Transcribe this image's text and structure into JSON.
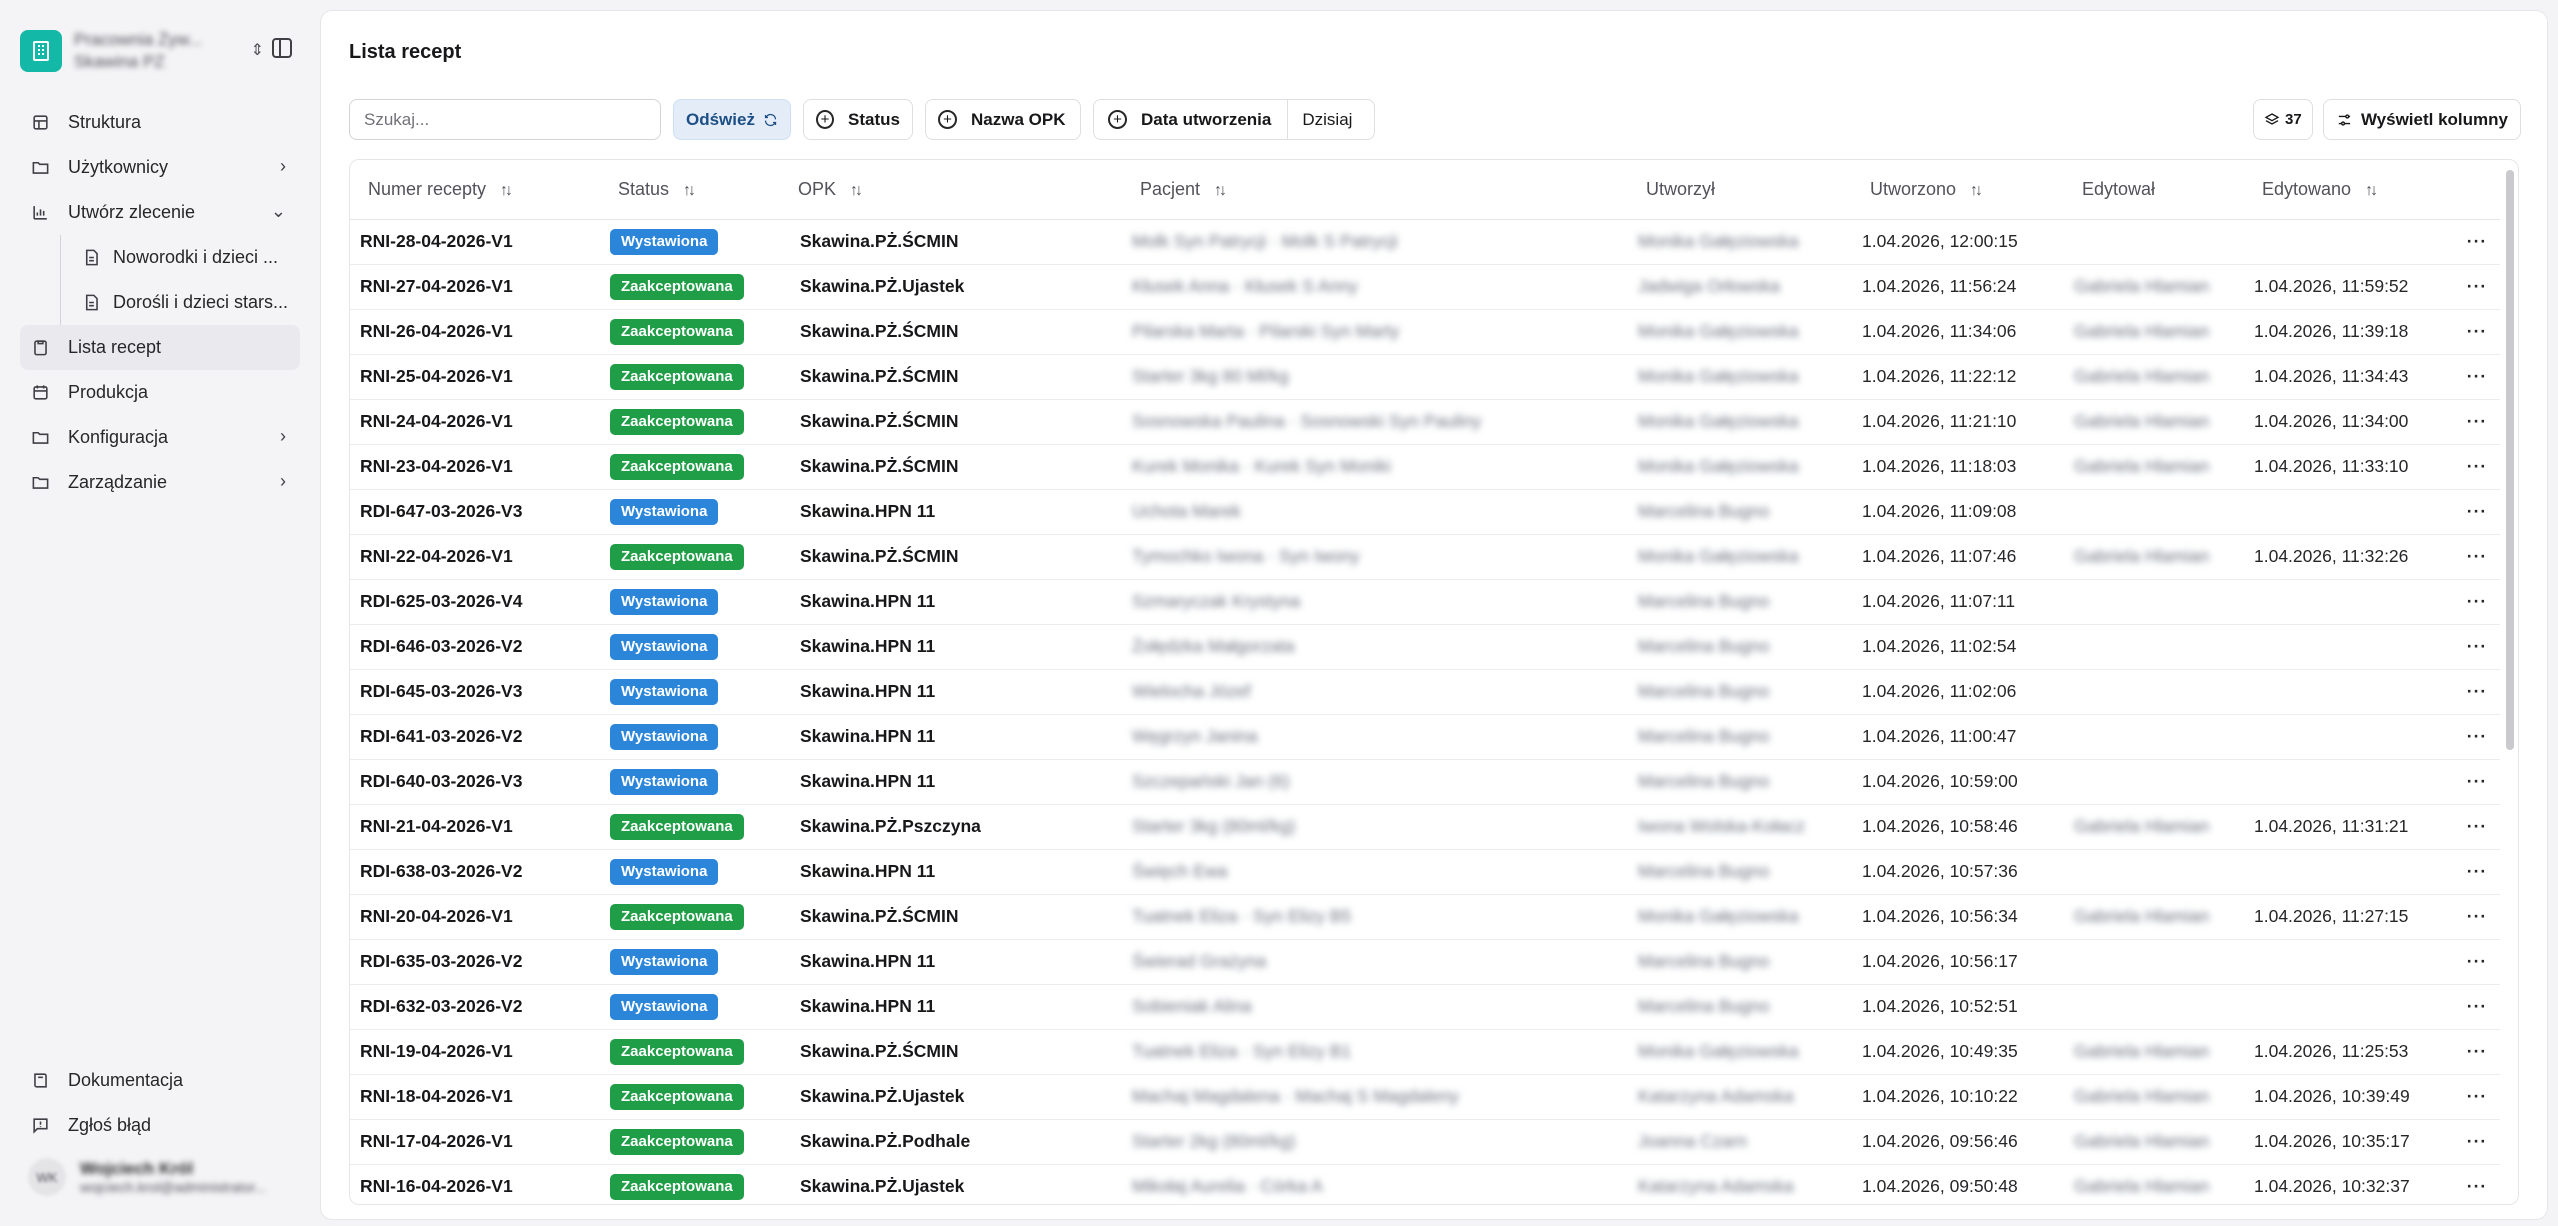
{
  "sidebar": {
    "org": {
      "name": "Pracownia Żyw...",
      "sub": "Skawina PZ"
    },
    "nav": [
      {
        "label": "Struktura",
        "icon": "building-icon"
      },
      {
        "label": "Użytkownicy",
        "icon": "folder-icon"
      },
      {
        "label": "Utwórz zlecenie",
        "icon": "chart-icon"
      },
      {
        "label": "Lista recept",
        "icon": "clipboard-icon"
      },
      {
        "label": "Produkcja",
        "icon": "calendar-icon"
      },
      {
        "label": "Konfiguracja",
        "icon": "folder-icon"
      },
      {
        "label": "Zarządzanie",
        "icon": "folder-icon"
      }
    ],
    "sub_items": [
      "Noworodki i dzieci ...",
      "Dorośli i dzieci stars..."
    ],
    "bottom": [
      "Dokumentacja",
      "Zgłoś błąd"
    ],
    "user": {
      "initials": "WK",
      "name": "Wojciech Król",
      "email": "wojciech.krol@administrator..."
    }
  },
  "main": {
    "title": "Lista recept",
    "toolbar": {
      "search_placeholder": "Szukaj...",
      "refresh": "Odśwież",
      "status": "Status",
      "opk": "Nazwa OPK",
      "date": "Data utworzenia",
      "date_value": "Dzisiaj",
      "count": "37",
      "columns": "Wyświetl kolumny"
    },
    "columns": [
      "Numer recepty",
      "Status",
      "OPK",
      "Pacjent",
      "Utworzył",
      "Utworzono",
      "Edytował",
      "Edytowano"
    ],
    "rows": [
      {
        "num": "RNI-28-04-2026-V1",
        "status": "Wystawiona",
        "opk": "Skawina.PŻ.ŚCMIN",
        "patient": "Molk Syn Patrycji · Molk S Patrycji",
        "created_by": "Monika Gałęziowska",
        "created": "1.04.2026, 12:00:15",
        "edited_by": "",
        "edited": ""
      },
      {
        "num": "RNI-27-04-2026-V1",
        "status": "Zaakceptowana",
        "opk": "Skawina.PŻ.Ujastek",
        "patient": "Kłusek Anna · Kłusek S Anny",
        "created_by": "Jadwiga Orłowska",
        "created": "1.04.2026, 11:56:24",
        "edited_by": "Gabriela Hlamian",
        "edited": "1.04.2026, 11:59:52"
      },
      {
        "num": "RNI-26-04-2026-V1",
        "status": "Zaakceptowana",
        "opk": "Skawina.PŻ.ŚCMIN",
        "patient": "Pilarska Marta · Pilarski Syn Marty",
        "created_by": "Monika Gałęziowska",
        "created": "1.04.2026, 11:34:06",
        "edited_by": "Gabriela Hlamian",
        "edited": "1.04.2026, 11:39:18"
      },
      {
        "num": "RNI-25-04-2026-V1",
        "status": "Zaakceptowana",
        "opk": "Skawina.PŻ.ŚCMIN",
        "patient": "Starter 3kg 80 Ml/kg",
        "created_by": "Monika Gałęziowska",
        "created": "1.04.2026, 11:22:12",
        "edited_by": "Gabriela Hlamian",
        "edited": "1.04.2026, 11:34:43"
      },
      {
        "num": "RNI-24-04-2026-V1",
        "status": "Zaakceptowana",
        "opk": "Skawina.PŻ.ŚCMIN",
        "patient": "Sosnowska Paulina · Sosnowski Syn Pauliny",
        "created_by": "Monika Gałęziowska",
        "created": "1.04.2026, 11:21:10",
        "edited_by": "Gabriela Hlamian",
        "edited": "1.04.2026, 11:34:00"
      },
      {
        "num": "RNI-23-04-2026-V1",
        "status": "Zaakceptowana",
        "opk": "Skawina.PŻ.ŚCMIN",
        "patient": "Kurek Monika · Kurek Syn Moniki",
        "created_by": "Monika Gałęziowska",
        "created": "1.04.2026, 11:18:03",
        "edited_by": "Gabriela Hlamian",
        "edited": "1.04.2026, 11:33:10"
      },
      {
        "num": "RDI-647-03-2026-V3",
        "status": "Wystawiona",
        "opk": "Skawina.HPN 11",
        "patient": "Uchota Marek",
        "created_by": "Marcelina Bugno",
        "created": "1.04.2026, 11:09:08",
        "edited_by": "",
        "edited": ""
      },
      {
        "num": "RNI-22-04-2026-V1",
        "status": "Zaakceptowana",
        "opk": "Skawina.PŻ.ŚCMIN",
        "patient": "Tymochko Iwona · Syn Iwony",
        "created_by": "Monika Gałęziowska",
        "created": "1.04.2026, 11:07:46",
        "edited_by": "Gabriela Hlamian",
        "edited": "1.04.2026, 11:32:26"
      },
      {
        "num": "RDI-625-03-2026-V4",
        "status": "Wystawiona",
        "opk": "Skawina.HPN 11",
        "patient": "Szmaryczak Krystyna",
        "created_by": "Marcelina Bugno",
        "created": "1.04.2026, 11:07:11",
        "edited_by": "",
        "edited": ""
      },
      {
        "num": "RDI-646-03-2026-V2",
        "status": "Wystawiona",
        "opk": "Skawina.HPN 11",
        "patient": "Żołędzka Małgorzata",
        "created_by": "Marcelina Bugno",
        "created": "1.04.2026, 11:02:54",
        "edited_by": "",
        "edited": ""
      },
      {
        "num": "RDI-645-03-2026-V3",
        "status": "Wystawiona",
        "opk": "Skawina.HPN 11",
        "patient": "Wielocha Józef",
        "created_by": "Marcelina Bugno",
        "created": "1.04.2026, 11:02:06",
        "edited_by": "",
        "edited": ""
      },
      {
        "num": "RDI-641-03-2026-V2",
        "status": "Wystawiona",
        "opk": "Skawina.HPN 11",
        "patient": "Węgrzyn Janina",
        "created_by": "Marcelina Bugno",
        "created": "1.04.2026, 11:00:47",
        "edited_by": "",
        "edited": ""
      },
      {
        "num": "RDI-640-03-2026-V3",
        "status": "Wystawiona",
        "opk": "Skawina.HPN 11",
        "patient": "Szczepański Jan (6)",
        "created_by": "Marcelina Bugno",
        "created": "1.04.2026, 10:59:00",
        "edited_by": "",
        "edited": ""
      },
      {
        "num": "RNI-21-04-2026-V1",
        "status": "Zaakceptowana",
        "opk": "Skawina.PŻ.Pszczyna",
        "patient": "Starter 3kg (80ml/kg)",
        "created_by": "Iwona Wolska-Kołacz",
        "created": "1.04.2026, 10:58:46",
        "edited_by": "Gabriela Hlamian",
        "edited": "1.04.2026, 11:31:21"
      },
      {
        "num": "RDI-638-03-2026-V2",
        "status": "Wystawiona",
        "opk": "Skawina.HPN 11",
        "patient": "Święch Ewa",
        "created_by": "Marcelina Bugno",
        "created": "1.04.2026, 10:57:36",
        "edited_by": "",
        "edited": ""
      },
      {
        "num": "RNI-20-04-2026-V1",
        "status": "Zaakceptowana",
        "opk": "Skawina.PŻ.ŚCMIN",
        "patient": "Tuatnek Eliza · Syn Elizy B5",
        "created_by": "Monika Gałęziowska",
        "created": "1.04.2026, 10:56:34",
        "edited_by": "Gabriela Hlamian",
        "edited": "1.04.2026, 11:27:15"
      },
      {
        "num": "RDI-635-03-2026-V2",
        "status": "Wystawiona",
        "opk": "Skawina.HPN 11",
        "patient": "Świerad Grażyna",
        "created_by": "Marcelina Bugno",
        "created": "1.04.2026, 10:56:17",
        "edited_by": "",
        "edited": ""
      },
      {
        "num": "RDI-632-03-2026-V2",
        "status": "Wystawiona",
        "opk": "Skawina.HPN 11",
        "patient": "Sobieniak Alina",
        "created_by": "Marcelina Bugno",
        "created": "1.04.2026, 10:52:51",
        "edited_by": "",
        "edited": ""
      },
      {
        "num": "RNI-19-04-2026-V1",
        "status": "Zaakceptowana",
        "opk": "Skawina.PŻ.ŚCMIN",
        "patient": "Tuatnek Eliza · Syn Elizy B1",
        "created_by": "Monika Gałęziowska",
        "created": "1.04.2026, 10:49:35",
        "edited_by": "Gabriela Hlamian",
        "edited": "1.04.2026, 11:25:53"
      },
      {
        "num": "RNI-18-04-2026-V1",
        "status": "Zaakceptowana",
        "opk": "Skawina.PŻ.Ujastek",
        "patient": "Machaj Magdalena · Machaj S Magdaleny",
        "created_by": "Katarzyna Adamska",
        "created": "1.04.2026, 10:10:22",
        "edited_by": "Gabriela Hlamian",
        "edited": "1.04.2026, 10:39:49"
      },
      {
        "num": "RNI-17-04-2026-V1",
        "status": "Zaakceptowana",
        "opk": "Skawina.PŻ.Podhale",
        "patient": "Starter 2kg (80ml/kg)",
        "created_by": "Joanna Czarn",
        "created": "1.04.2026, 09:56:46",
        "edited_by": "Gabriela Hlamian",
        "edited": "1.04.2026, 10:35:17"
      },
      {
        "num": "RNI-16-04-2026-V1",
        "status": "Zaakceptowana",
        "opk": "Skawina.PŻ.Ujastek",
        "patient": "Mikołaj Aurelia · Córka A",
        "created_by": "Katarzyna Adamska",
        "created": "1.04.2026, 09:50:48",
        "edited_by": "Gabriela Hlamian",
        "edited": "1.04.2026, 10:32:37"
      }
    ]
  }
}
